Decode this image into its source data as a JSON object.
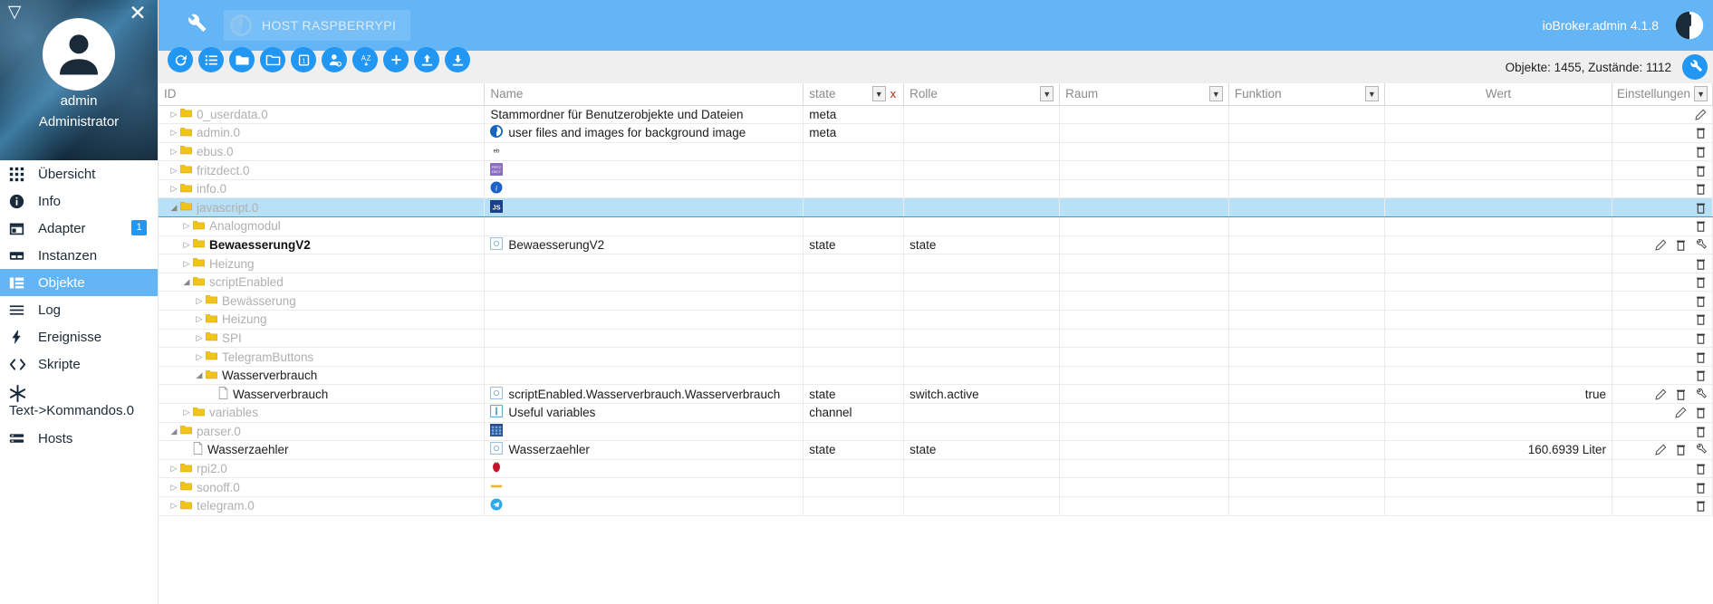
{
  "sidebar": {
    "collapse_icon": "triangle-left-icon",
    "close_icon": "close-icon",
    "user": {
      "name": "admin",
      "role": "Administrator"
    },
    "items": [
      {
        "label": "Übersicht",
        "icon": "apps-grid-icon",
        "selected": false,
        "badge": null
      },
      {
        "label": "Info",
        "icon": "info-circle-icon",
        "selected": false,
        "badge": null
      },
      {
        "label": "Adapter",
        "icon": "store-icon",
        "selected": false,
        "badge": "1"
      },
      {
        "label": "Instanzen",
        "icon": "instances-icon",
        "selected": false,
        "badge": null
      },
      {
        "label": "Objekte",
        "icon": "objects-list-icon",
        "selected": true,
        "badge": null
      },
      {
        "label": "Log",
        "icon": "lines-icon",
        "selected": false,
        "badge": null
      },
      {
        "label": "Ereignisse",
        "icon": "bolt-icon",
        "selected": false,
        "badge": null
      },
      {
        "label": "Skripte",
        "icon": "code-brackets-icon",
        "selected": false,
        "badge": null
      },
      {
        "label": "Text->Kommandos.0",
        "icon": "snowflake-icon",
        "selected": false,
        "badge": null,
        "stacked": true
      },
      {
        "label": "Hosts",
        "icon": "hosts-icon",
        "selected": false,
        "badge": null
      }
    ]
  },
  "appbar": {
    "wrench_icon": "wrench-icon",
    "host_chip": {
      "icon": "iobroker-logo-icon",
      "label": "HOST RASPBERRYPI"
    },
    "version": "ioBroker.admin 4.1.8",
    "logo_icon": "iobroker-logo-icon"
  },
  "toolbar": {
    "buttons": [
      {
        "name": "refresh-button",
        "icon": "refresh-icon"
      },
      {
        "name": "expand-all-button",
        "icon": "list-icon"
      },
      {
        "name": "collapse-folders-button",
        "icon": "folder-filled-icon"
      },
      {
        "name": "expand-folders-button",
        "icon": "folder-outline-icon"
      },
      {
        "name": "expand-level-button",
        "icon": "level-one-icon",
        "text": "1"
      },
      {
        "name": "toggle-expert-button",
        "icon": "expert-user-icon"
      },
      {
        "name": "sort-button",
        "icon": "az-sort-icon"
      },
      {
        "name": "add-object-button",
        "icon": "plus-icon"
      },
      {
        "name": "import-button",
        "icon": "upload-icon"
      },
      {
        "name": "export-button",
        "icon": "download-icon"
      }
    ],
    "counts": "Objekte: 1455, Zustände: 1112",
    "settings_icon": "wrench-icon"
  },
  "table": {
    "columns": [
      {
        "key": "id",
        "label": "ID",
        "filtered": false,
        "caret": false,
        "align": "left"
      },
      {
        "key": "name",
        "label": "Name",
        "filtered": false,
        "caret": false,
        "align": "left"
      },
      {
        "key": "type",
        "label": "state",
        "filtered": true,
        "caret": true,
        "clear": "x",
        "align": "left"
      },
      {
        "key": "role",
        "label": "Rolle",
        "filtered": false,
        "caret": true,
        "align": "left"
      },
      {
        "key": "room",
        "label": "Raum",
        "filtered": false,
        "caret": true,
        "align": "left"
      },
      {
        "key": "func",
        "label": "Funktion",
        "filtered": false,
        "caret": true,
        "align": "left"
      },
      {
        "key": "value",
        "label": "Wert",
        "filtered": false,
        "caret": false,
        "align": "center"
      },
      {
        "key": "settings",
        "label": "Einstellungen",
        "filtered": false,
        "caret": true,
        "align": "center"
      }
    ],
    "rows": [
      {
        "indent": 0,
        "twisty": "collapsed",
        "icon": "folder-icon",
        "id": "0_userdata.0",
        "dim": true,
        "name": "Stammordner für Benutzerobjekte und Dateien",
        "name_icon": null,
        "type": "meta",
        "role": "",
        "room": "",
        "func": "",
        "value": "",
        "actions": [
          "edit"
        ]
      },
      {
        "indent": 0,
        "twisty": "collapsed",
        "icon": "folder-icon",
        "id": "admin.0",
        "dim": true,
        "name": "user files and images for background image",
        "name_icon": "iobroker-badge",
        "type": "meta",
        "role": "",
        "room": "",
        "func": "",
        "value": "",
        "actions": [
          "delete"
        ]
      },
      {
        "indent": 0,
        "twisty": "collapsed",
        "icon": "folder-icon",
        "id": "ebus.0",
        "dim": true,
        "name": "",
        "name_icon": "ebus-badge",
        "type": "",
        "role": "",
        "room": "",
        "func": "",
        "value": "",
        "actions": [
          "delete"
        ]
      },
      {
        "indent": 0,
        "twisty": "collapsed",
        "icon": "folder-icon",
        "id": "fritzdect.0",
        "dim": true,
        "name": "",
        "name_icon": "fritzdect-badge",
        "type": "",
        "role": "",
        "room": "",
        "func": "",
        "value": "",
        "actions": [
          "delete"
        ]
      },
      {
        "indent": 0,
        "twisty": "collapsed",
        "icon": "folder-icon",
        "id": "info.0",
        "dim": true,
        "name": "",
        "name_icon": "info-badge",
        "type": "",
        "role": "",
        "room": "",
        "func": "",
        "value": "",
        "actions": [
          "delete"
        ]
      },
      {
        "indent": 0,
        "twisty": "expanded",
        "icon": "folder-icon",
        "id": "javascript.0",
        "dim": true,
        "selected": true,
        "name": "",
        "name_icon": "js-badge",
        "type": "",
        "role": "",
        "room": "",
        "func": "",
        "value": "",
        "actions": [
          "delete"
        ]
      },
      {
        "indent": 1,
        "twisty": "collapsed",
        "icon": "folder-icon",
        "id": "Analogmodul",
        "dim": true,
        "name": "",
        "name_icon": null,
        "type": "",
        "role": "",
        "room": "",
        "func": "",
        "value": "",
        "actions": [
          "delete"
        ]
      },
      {
        "indent": 1,
        "twisty": "collapsed",
        "icon": "folder-icon",
        "id": "BewaesserungV2",
        "dim": false,
        "bold": true,
        "name": "BewaesserungV2",
        "name_icon": "state-badge",
        "type": "state",
        "role": "state",
        "room": "",
        "func": "",
        "value": "",
        "actions": [
          "edit",
          "delete",
          "wrench"
        ]
      },
      {
        "indent": 1,
        "twisty": "collapsed",
        "icon": "folder-icon",
        "id": "Heizung",
        "dim": true,
        "name": "",
        "name_icon": null,
        "type": "",
        "role": "",
        "room": "",
        "func": "",
        "value": "",
        "actions": [
          "delete"
        ]
      },
      {
        "indent": 1,
        "twisty": "expanded",
        "icon": "folder-icon",
        "id": "scriptEnabled",
        "dim": true,
        "name": "",
        "name_icon": null,
        "type": "",
        "role": "",
        "room": "",
        "func": "",
        "value": "",
        "actions": [
          "delete"
        ]
      },
      {
        "indent": 2,
        "twisty": "collapsed",
        "icon": "folder-icon",
        "id": "Bewässerung",
        "dim": true,
        "name": "",
        "name_icon": null,
        "type": "",
        "role": "",
        "room": "",
        "func": "",
        "value": "",
        "actions": [
          "delete"
        ]
      },
      {
        "indent": 2,
        "twisty": "collapsed",
        "icon": "folder-icon",
        "id": "Heizung",
        "dim": true,
        "name": "",
        "name_icon": null,
        "type": "",
        "role": "",
        "room": "",
        "func": "",
        "value": "",
        "actions": [
          "delete"
        ]
      },
      {
        "indent": 2,
        "twisty": "collapsed",
        "icon": "folder-icon",
        "id": "SPI",
        "dim": true,
        "name": "",
        "name_icon": null,
        "type": "",
        "role": "",
        "room": "",
        "func": "",
        "value": "",
        "actions": [
          "delete"
        ]
      },
      {
        "indent": 2,
        "twisty": "collapsed",
        "icon": "folder-icon",
        "id": "TelegramButtons",
        "dim": true,
        "name": "",
        "name_icon": null,
        "type": "",
        "role": "",
        "room": "",
        "func": "",
        "value": "",
        "actions": [
          "delete"
        ]
      },
      {
        "indent": 2,
        "twisty": "expanded",
        "icon": "folder-icon",
        "id": "Wasserverbrauch",
        "dim": false,
        "name": "",
        "name_icon": null,
        "type": "",
        "role": "",
        "room": "",
        "func": "",
        "value": "",
        "actions": [
          "delete"
        ]
      },
      {
        "indent": 3,
        "twisty": "none",
        "icon": "doc-icon",
        "id": "Wasserverbrauch",
        "dim": false,
        "name": "scriptEnabled.Wasserverbrauch.Wasserverbrauch",
        "name_icon": "state-badge",
        "type": "state",
        "role": "switch.active",
        "room": "",
        "func": "",
        "value": "true",
        "actions": [
          "edit",
          "delete",
          "wrench"
        ]
      },
      {
        "indent": 1,
        "twisty": "collapsed",
        "icon": "folder-icon",
        "id": "variables",
        "dim": true,
        "name": "Useful variables",
        "name_icon": "channel-badge",
        "type": "channel",
        "role": "",
        "room": "",
        "func": "",
        "value": "",
        "actions": [
          "edit",
          "delete"
        ]
      },
      {
        "indent": 0,
        "twisty": "expanded",
        "icon": "folder-icon",
        "id": "parser.0",
        "dim": true,
        "name": "",
        "name_icon": "parser-badge",
        "type": "",
        "role": "",
        "room": "",
        "func": "",
        "value": "",
        "actions": [
          "delete"
        ]
      },
      {
        "indent": 1,
        "twisty": "none",
        "icon": "doc-icon",
        "id": "Wasserzaehler",
        "dim": false,
        "name": "Wasserzaehler",
        "name_icon": "state-badge",
        "type": "state",
        "role": "state",
        "room": "",
        "func": "",
        "value": "160.6939 Liter",
        "actions": [
          "edit",
          "delete",
          "wrench"
        ]
      },
      {
        "indent": 0,
        "twisty": "collapsed",
        "icon": "folder-icon",
        "id": "rpi2.0",
        "dim": true,
        "name": "",
        "name_icon": "rpi-badge",
        "type": "",
        "role": "",
        "room": "",
        "func": "",
        "value": "",
        "actions": [
          "delete"
        ]
      },
      {
        "indent": 0,
        "twisty": "collapsed",
        "icon": "folder-icon",
        "id": "sonoff.0",
        "dim": true,
        "name": "",
        "name_icon": "sonoff-badge",
        "type": "",
        "role": "",
        "room": "",
        "func": "",
        "value": "",
        "actions": [
          "delete"
        ]
      },
      {
        "indent": 0,
        "twisty": "collapsed",
        "icon": "folder-icon",
        "id": "telegram.0",
        "dim": true,
        "name": "",
        "name_icon": "telegram-badge",
        "type": "",
        "role": "",
        "room": "",
        "func": "",
        "value": "",
        "actions": [
          "delete"
        ]
      }
    ]
  },
  "colors": {
    "accent": "#2196f3",
    "appbar": "#64b5f6",
    "filter_highlight": "#f5b0a4",
    "row_selected": "#b8e0f7",
    "folder": "#f0c419"
  }
}
